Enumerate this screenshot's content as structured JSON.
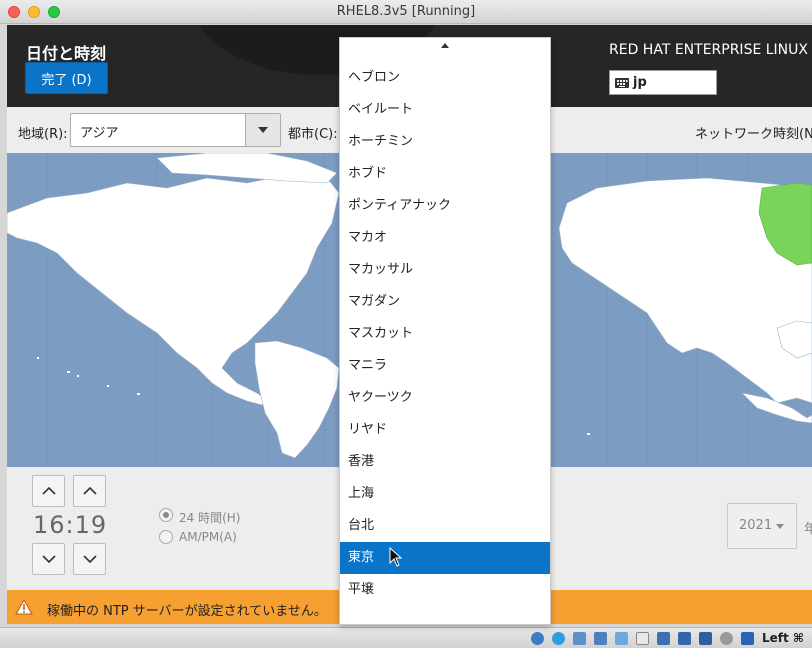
{
  "window": {
    "title": "RHEL8.3v5 [Running]"
  },
  "header": {
    "page_title": "日付と時刻",
    "done_button": "完了 (D)",
    "product": "RED HAT ENTERPRISE LINUX",
    "keyboard_layout": "jp"
  },
  "toolbar": {
    "region_label": "地域(R):",
    "region_value": "アジア",
    "city_label": "都市(C):",
    "network_time_label": "ネットワーク時刻(N"
  },
  "colors": {
    "ocean": "#7d9cc2",
    "land": "#ffffff",
    "highlight_zone": "#7ad45a",
    "accent": "#0a74c9",
    "warning": "#f5a031"
  },
  "time": {
    "clock": "16:19",
    "format_24h": "24 時間(H)",
    "format_ampm": "AM/PM(A)",
    "selected_format": "24h",
    "year": "2021",
    "year_unit": "年"
  },
  "city_dropdown": {
    "items": [
      "ヘブロン",
      "ベイルート",
      "ホーチミン",
      "ホブド",
      "ポンティアナック",
      "マカオ",
      "マカッサル",
      "マガダン",
      "マスカット",
      "マニラ",
      "ヤクーツク",
      "リヤド",
      "香港",
      "上海",
      "台北",
      "東京",
      "平壌"
    ],
    "selected": "東京"
  },
  "warning": {
    "text": "稼働中の NTP サーバーが設定されていません。"
  },
  "statusbar": {
    "host_key": "Left ⌘"
  }
}
